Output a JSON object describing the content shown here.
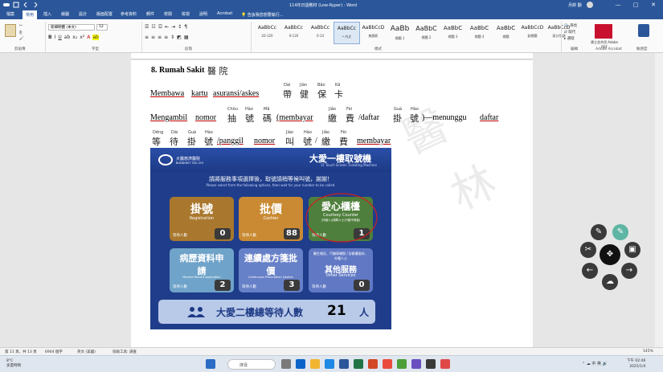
{
  "window": {
    "title": "114年日語教材 (Low-Ryper) - Word",
    "user_name": "月餅 翻",
    "min": "—",
    "max": "▢",
    "close": "✕"
  },
  "tabs": [
    "檔案",
    "常用",
    "插入",
    "繪圖",
    "設計",
    "版面配置",
    "參考資料",
    "郵件",
    "校閱",
    "檢視",
    "說明",
    "Acrobat"
  ],
  "tell_me": "告訴我您想要執行...",
  "ribbon": {
    "font_name": "新細明體 (本文)",
    "font_size": "12",
    "groups": [
      "剪貼簿",
      "字型",
      "段落",
      "樣式",
      "編輯",
      "Adobe Acrobat",
      "敏感度"
    ],
    "styles": [
      {
        "preview": "AaBbCc",
        "name": "20-120"
      },
      {
        "preview": "AaBbCc",
        "name": "0-120"
      },
      {
        "preview": "AaBbCc",
        "name": "0-14"
      },
      {
        "preview": "AaBbCc",
        "name": "• 內文"
      },
      {
        "preview": "AaBbCcD",
        "name": "無間距"
      },
      {
        "preview": "AaBb",
        "name": "標題 1"
      },
      {
        "preview": "AaBbC",
        "name": "標題 2"
      },
      {
        "preview": "AaBbC",
        "name": "標題 3"
      },
      {
        "preview": "AaBbC",
        "name": "標題 4"
      },
      {
        "preview": "AaBbC",
        "name": "標題"
      },
      {
        "preview": "AaBbCcD",
        "name": "副標題"
      },
      {
        "preview": "AaBbCcD",
        "name": "區分強調"
      }
    ],
    "edit_items": [
      "尋找",
      "取代",
      "選取"
    ],
    "adobe_label": "建立並共用 Adobe PDF"
  },
  "document": {
    "heading": "8. Rumah Sakit",
    "heading_han": "醫 院",
    "line1": {
      "parts": [
        "Membawa",
        "kartu",
        "asuransi/askes"
      ],
      "han": [
        "帶",
        "健",
        "保",
        "卡"
      ],
      "ruby": [
        "Dài",
        "Jiàn",
        "Bǎo",
        "Kǎ"
      ]
    },
    "line2": {
      "text_a": "Mengambil",
      "text_b": "nomor",
      "han_a": [
        "抽",
        "號",
        "碼"
      ],
      "ruby_a": [
        "Chōu",
        "Hào",
        "Mǎ"
      ],
      "text_c": "(membayar",
      "han_b": [
        "繳",
        "費"
      ],
      "ruby_b": [
        "Jiǎo",
        "Fèi"
      ],
      "text_d": "/daftar",
      "han_c": [
        "掛",
        "號"
      ],
      "ruby_c": [
        "Guà",
        "Hào"
      ],
      "text_e": ")—menunggu",
      "text_f": "daftar"
    },
    "line3": {
      "han_a": [
        "等",
        "待",
        "掛",
        "號"
      ],
      "ruby_a": [
        "Děng",
        "Dài",
        "Guà",
        "Hào"
      ],
      "text_a": "/panggil",
      "text_b": "nomor",
      "han_b": [
        "叫",
        "號"
      ],
      "ruby_b": [
        "Jiào",
        "Hào"
      ],
      "han_c": [
        "繳",
        "費"
      ],
      "ruby_c": [
        "Jiǎo",
        "Fèi"
      ],
      "text_c": "membayar"
    }
  },
  "kiosk": {
    "hospital": "大醫慈濟醫院",
    "hospital_en": "BUDDHIST TZU CHI",
    "title": "大愛一樓取號機",
    "subtitle": "1F Touch Screen Ticketing Machine",
    "prompt": "請將服務事項選擇後，取號請稍等候叫號，謝謝！",
    "prompt_en": "Please select from the following options, then wait for your number to be called.",
    "wait_label": "等待人數",
    "wait_sub": "Waiting Number of Visitors",
    "buttons": [
      {
        "zh": "掛號",
        "en": "Registration",
        "count": "0",
        "color": "#a9782e"
      },
      {
        "zh": "批價",
        "en": "Cashier",
        "count": "88",
        "color": "#c98a33"
      },
      {
        "zh": "愛心櫃檯",
        "en": "Courtesy Counter",
        "en2": "(外國人)(殘障人士/行動不便者)",
        "count": "1",
        "color": "#4f7f3c"
      },
      {
        "zh": "病歷資料申請",
        "en": "Medical Record Application",
        "count": "2",
        "color": "#6fa3c9"
      },
      {
        "zh": "連續處方箋批價",
        "en": "Continuous Prescription Cashier",
        "count": "3",
        "color": "#6781c8"
      },
      {
        "zh": "其他服務",
        "en": "Other Services",
        "en2": "醫生報告、汽機車補照 / 診斷書副本、外籍人士",
        "count": "0",
        "color": "#6179c4"
      }
    ],
    "total_label": "大愛二樓總等待人數",
    "total_count": "21",
    "total_unit": "人"
  },
  "statusbar": {
    "page": "第 11 頁，共 13 頁",
    "words": "6904 個字",
    "lang": "英文 (美國)",
    "a11y": "協助工具: 調查",
    "zoom": "145%"
  },
  "taskbar": {
    "weather_temp": "8°C",
    "weather_desc": "多雲時晴",
    "search": "搜尋",
    "tray_lang": "中",
    "tray_ime": "英",
    "time": "下午 02:46",
    "date": "2025/1/4"
  }
}
